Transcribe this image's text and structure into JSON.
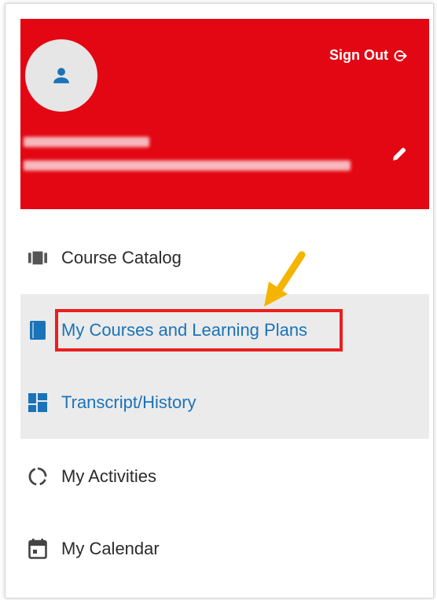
{
  "header": {
    "sign_out_label": "Sign Out",
    "background_color": "#e30613"
  },
  "menu": {
    "items": [
      {
        "label": "Course Catalog",
        "icon": "catalog-icon"
      },
      {
        "label": "My Courses and Learning Plans",
        "icon": "book-icon"
      },
      {
        "label": "Transcript/History",
        "icon": "dashboard-icon"
      },
      {
        "label": "My Activities",
        "icon": "progress-circle-icon"
      },
      {
        "label": "My Calendar",
        "icon": "calendar-icon"
      }
    ],
    "link_color": "#1a73b8",
    "highlight_color": "#ea1f1f"
  }
}
